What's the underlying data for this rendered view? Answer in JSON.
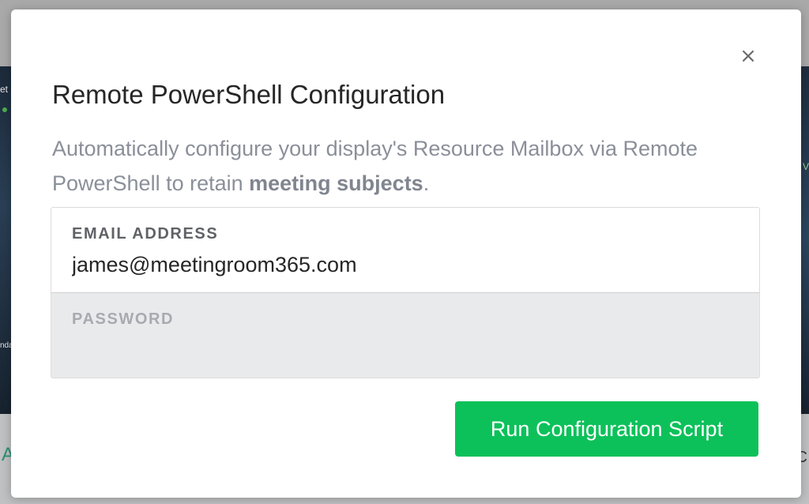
{
  "background": {
    "fragments": {
      "left_top": "et",
      "left_bottom": "nda",
      "right_mid": "V",
      "letter_left": "A",
      "letter_right": "C"
    }
  },
  "modal": {
    "close_label": "×",
    "title": "Remote PowerShell Configuration",
    "description": {
      "prefix": "Automatically configure your display's Resource Mailbox via Remote PowerShell to retain ",
      "emphasis": "meeting subjects",
      "suffix": "."
    },
    "email": {
      "label": "EMAIL ADDRESS",
      "value": "james@meetingroom365.com",
      "placeholder": ""
    },
    "password": {
      "label": "PASSWORD",
      "value": "",
      "placeholder": ""
    },
    "run_button_label": "Run Configuration Script"
  },
  "colors": {
    "accent": "#0cc15a",
    "title": "#262626",
    "description": "#8a8f99",
    "password_field_bg": "#e9eaec"
  }
}
